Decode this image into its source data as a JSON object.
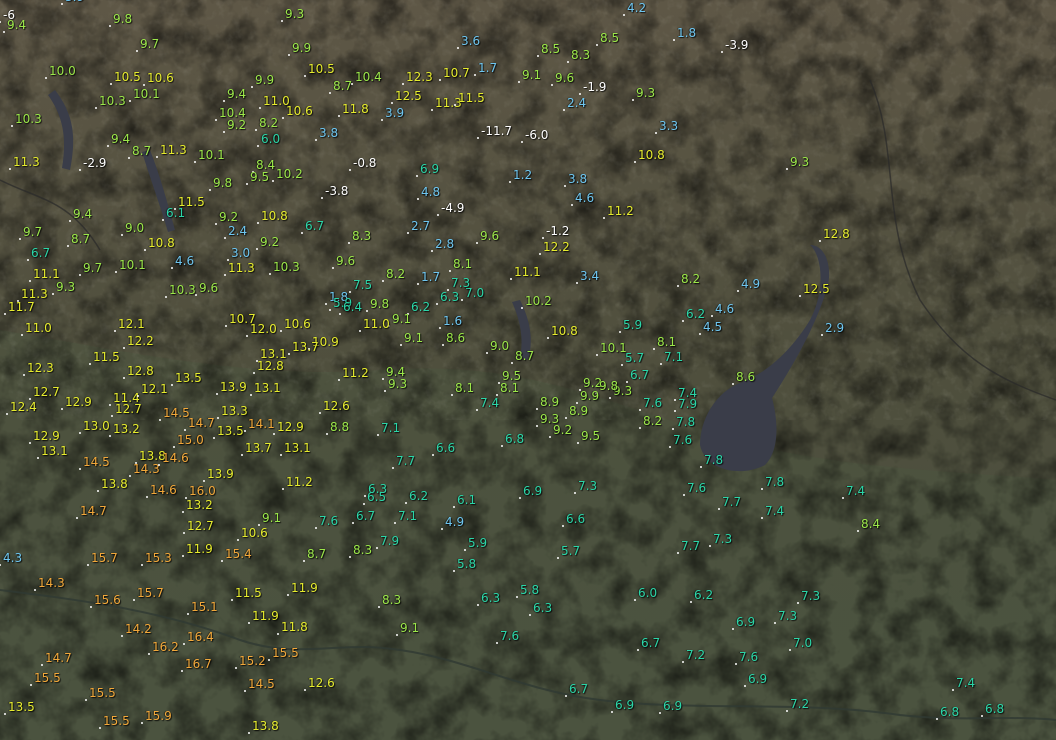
{
  "colors": {
    "mountain": "#55503f",
    "plain": "#4e533f",
    "lake": "#3b3f4a",
    "cold": "#ffffff",
    "cool": "#6ec6f0",
    "mild": "#2bd6a8",
    "warm": "#9ce84a",
    "warmer": "#e6ec2e",
    "hot": "#f2a83a"
  },
  "stations": [
    {
      "t": "-6.0"
    },
    {
      "t": "-3.9"
    },
    {
      "t": "-2.9"
    },
    {
      "t": "-1.9"
    },
    {
      "t": "-1.2"
    },
    {
      "t": "-0.8"
    },
    {
      "t": "-11.7"
    },
    {
      "t": "-3.8"
    },
    {
      "t": "-4.9"
    },
    {
      "t": "1.2"
    },
    {
      "t": "1.6"
    },
    {
      "t": "1.7"
    },
    {
      "t": "1.7"
    },
    {
      "t": "1.8"
    },
    {
      "t": "1.8"
    },
    {
      "t": "2.4"
    },
    {
      "t": "2.4"
    },
    {
      "t": "2.7"
    },
    {
      "t": "2.8"
    },
    {
      "t": "2.9"
    },
    {
      "t": "3.0"
    },
    {
      "t": "3.3"
    },
    {
      "t": "3.4"
    },
    {
      "t": "3.6"
    },
    {
      "t": "3.8"
    },
    {
      "t": "3.8"
    },
    {
      "t": "3.9"
    },
    {
      "t": "4.2"
    },
    {
      "t": "4.5"
    },
    {
      "t": "4.6"
    },
    {
      "t": "4.6"
    },
    {
      "t": "4.6"
    },
    {
      "t": "4.8"
    },
    {
      "t": "4.9"
    },
    {
      "t": "4.9"
    },
    {
      "t": "5.7"
    },
    {
      "t": "5.7"
    },
    {
      "t": "5.8"
    },
    {
      "t": "5.8"
    },
    {
      "t": "5.9"
    },
    {
      "t": "5.9"
    },
    {
      "t": "5.9"
    },
    {
      "t": "6.0"
    },
    {
      "t": "6.0"
    },
    {
      "t": "6.1"
    },
    {
      "t": "6.1"
    },
    {
      "t": "6.2"
    },
    {
      "t": "6.2"
    },
    {
      "t": "6.2"
    },
    {
      "t": "6.2"
    },
    {
      "t": "6.3"
    },
    {
      "t": "6.3"
    },
    {
      "t": "6.3"
    },
    {
      "t": "6.3"
    },
    {
      "t": "6.4"
    },
    {
      "t": "6.5"
    },
    {
      "t": "6.6"
    },
    {
      "t": "6.6"
    },
    {
      "t": "6.7"
    },
    {
      "t": "6.7"
    },
    {
      "t": "6.7"
    },
    {
      "t": "6.7"
    },
    {
      "t": "6.7"
    },
    {
      "t": "6.7"
    },
    {
      "t": "6.8"
    },
    {
      "t": "6.8"
    },
    {
      "t": "6.8"
    },
    {
      "t": "6.9"
    },
    {
      "t": "6.9"
    },
    {
      "t": "6.9"
    },
    {
      "t": "6.9"
    },
    {
      "t": "6.9"
    },
    {
      "t": "6.9"
    },
    {
      "t": "7.0"
    },
    {
      "t": "7.0"
    },
    {
      "t": "7.1"
    },
    {
      "t": "7.1"
    },
    {
      "t": "7.1"
    },
    {
      "t": "7.2"
    },
    {
      "t": "7.2"
    },
    {
      "t": "7.3"
    },
    {
      "t": "7.3"
    },
    {
      "t": "7.3"
    },
    {
      "t": "7.3"
    },
    {
      "t": "7.3"
    },
    {
      "t": "7.4"
    },
    {
      "t": "7.4"
    },
    {
      "t": "7.4"
    },
    {
      "t": "7.4"
    },
    {
      "t": "7.4"
    },
    {
      "t": "7.5"
    },
    {
      "t": "7.6"
    },
    {
      "t": "7.6"
    },
    {
      "t": "7.6"
    },
    {
      "t": "7.6"
    },
    {
      "t": "7.6"
    },
    {
      "t": "7.6"
    },
    {
      "t": "7.7"
    },
    {
      "t": "7.7"
    },
    {
      "t": "7.7"
    },
    {
      "t": "7.8"
    },
    {
      "t": "7.8"
    },
    {
      "t": "7.8"
    },
    {
      "t": "7.9"
    },
    {
      "t": "7.9"
    },
    {
      "t": "8.1"
    },
    {
      "t": "8.1"
    },
    {
      "t": "8.1"
    },
    {
      "t": "8.1"
    },
    {
      "t": "8.2"
    },
    {
      "t": "8.2"
    },
    {
      "t": "8.2"
    },
    {
      "t": "8.2"
    },
    {
      "t": "8.3"
    },
    {
      "t": "8.3"
    },
    {
      "t": "8.3"
    },
    {
      "t": "8.3"
    },
    {
      "t": "8.4"
    },
    {
      "t": "8.4"
    },
    {
      "t": "8.5"
    },
    {
      "t": "8.5"
    },
    {
      "t": "8.6"
    },
    {
      "t": "8.6"
    },
    {
      "t": "8.7"
    },
    {
      "t": "8.7"
    },
    {
      "t": "8.7"
    },
    {
      "t": "8.7"
    },
    {
      "t": "8.7"
    },
    {
      "t": "8.8"
    },
    {
      "t": "8.9"
    },
    {
      "t": "8.9"
    },
    {
      "t": "9.0"
    },
    {
      "t": "9.0"
    },
    {
      "t": "9.1"
    },
    {
      "t": "9.1"
    },
    {
      "t": "9.1"
    },
    {
      "t": "9.1"
    },
    {
      "t": "9.1"
    },
    {
      "t": "9.2"
    },
    {
      "t": "9.2"
    },
    {
      "t": "9.2"
    },
    {
      "t": "9.2"
    },
    {
      "t": "9.2"
    },
    {
      "t": "9.3"
    },
    {
      "t": "9.3"
    },
    {
      "t": "9.3"
    },
    {
      "t": "9.3"
    },
    {
      "t": "9.3"
    },
    {
      "t": "9.3"
    },
    {
      "t": "9.3"
    },
    {
      "t": "9.4"
    },
    {
      "t": "9.4"
    },
    {
      "t": "9.4"
    },
    {
      "t": "9.4"
    },
    {
      "t": "9.4"
    },
    {
      "t": "9.5"
    },
    {
      "t": "9.5"
    },
    {
      "t": "9.5"
    },
    {
      "t": "9.6"
    },
    {
      "t": "9.6"
    },
    {
      "t": "9.6"
    },
    {
      "t": "9.6"
    },
    {
      "t": "9.7"
    },
    {
      "t": "9.7"
    },
    {
      "t": "9.7"
    },
    {
      "t": "9.8"
    },
    {
      "t": "9.8"
    },
    {
      "t": "9.8"
    },
    {
      "t": "9.8"
    },
    {
      "t": "9.9"
    },
    {
      "t": "9.9"
    },
    {
      "t": "9.9"
    },
    {
      "t": "10.0"
    },
    {
      "t": "10.1"
    },
    {
      "t": "10.1"
    },
    {
      "t": "10.1"
    },
    {
      "t": "10.1"
    },
    {
      "t": "10.2"
    },
    {
      "t": "10.2"
    },
    {
      "t": "10.3"
    },
    {
      "t": "10.3"
    },
    {
      "t": "10.3"
    },
    {
      "t": "10.3"
    },
    {
      "t": "10.4"
    },
    {
      "t": "10.4"
    },
    {
      "t": "10.5"
    },
    {
      "t": "10.5"
    },
    {
      "t": "10.6"
    },
    {
      "t": "10.6"
    },
    {
      "t": "10.6"
    },
    {
      "t": "10.6"
    },
    {
      "t": "10.7"
    },
    {
      "t": "10.7"
    },
    {
      "t": "10.8"
    },
    {
      "t": "10.8"
    },
    {
      "t": "10.8"
    },
    {
      "t": "10.8"
    },
    {
      "t": "10.9"
    },
    {
      "t": "11.0"
    },
    {
      "t": "11.0"
    },
    {
      "t": "11.0"
    },
    {
      "t": "11.1"
    },
    {
      "t": "11.1"
    },
    {
      "t": "11.2"
    },
    {
      "t": "11.2"
    },
    {
      "t": "11.2"
    },
    {
      "t": "11.3"
    },
    {
      "t": "11.3"
    },
    {
      "t": "11.3"
    },
    {
      "t": "11.3"
    },
    {
      "t": "11.3"
    },
    {
      "t": "11.4"
    },
    {
      "t": "11.5"
    },
    {
      "t": "11.5"
    },
    {
      "t": "11.5"
    },
    {
      "t": "11.5"
    },
    {
      "t": "11.7"
    },
    {
      "t": "11.8"
    },
    {
      "t": "11.8"
    },
    {
      "t": "11.9"
    },
    {
      "t": "11.9"
    },
    {
      "t": "11.9"
    },
    {
      "t": "12.0"
    },
    {
      "t": "12.1"
    },
    {
      "t": "12.1"
    },
    {
      "t": "12.2"
    },
    {
      "t": "12.2"
    },
    {
      "t": "12.3"
    },
    {
      "t": "12.3"
    },
    {
      "t": "12.4"
    },
    {
      "t": "12.5"
    },
    {
      "t": "12.5"
    },
    {
      "t": "12.6"
    },
    {
      "t": "12.6"
    },
    {
      "t": "12.7"
    },
    {
      "t": "12.7"
    },
    {
      "t": "12.7"
    },
    {
      "t": "12.8"
    },
    {
      "t": "12.8"
    },
    {
      "t": "12.8"
    },
    {
      "t": "12.9"
    },
    {
      "t": "12.9"
    },
    {
      "t": "12.9"
    },
    {
      "t": "13.0"
    },
    {
      "t": "13.1"
    },
    {
      "t": "13.1"
    },
    {
      "t": "13.1"
    },
    {
      "t": "13.1"
    },
    {
      "t": "13.2"
    },
    {
      "t": "13.2"
    },
    {
      "t": "13.3"
    },
    {
      "t": "13.5"
    },
    {
      "t": "13.5"
    },
    {
      "t": "13.5"
    },
    {
      "t": "13.7"
    },
    {
      "t": "13.7"
    },
    {
      "t": "13.8"
    },
    {
      "t": "13.8"
    },
    {
      "t": "13.8"
    },
    {
      "t": "13.9"
    },
    {
      "t": "13.9"
    },
    {
      "t": "14.1"
    },
    {
      "t": "14.2"
    },
    {
      "t": "14.3"
    },
    {
      "t": "14.3"
    },
    {
      "t": "14.5"
    },
    {
      "t": "14.5"
    },
    {
      "t": "14.5"
    },
    {
      "t": "14.6"
    },
    {
      "t": "14.6"
    },
    {
      "t": "14.7"
    },
    {
      "t": "14.7"
    },
    {
      "t": "14.7"
    },
    {
      "t": "15.0"
    },
    {
      "t": "15.1"
    },
    {
      "t": "15.2"
    },
    {
      "t": "15.3"
    },
    {
      "t": "15.4"
    },
    {
      "t": "15.5"
    },
    {
      "t": "15.5"
    },
    {
      "t": "15.5"
    },
    {
      "t": "15.5"
    },
    {
      "t": "15.6"
    },
    {
      "t": "15.7"
    },
    {
      "t": "15.7"
    },
    {
      "t": "15.9"
    },
    {
      "t": "16.0"
    },
    {
      "t": "16.2"
    },
    {
      "t": "16.4"
    },
    {
      "t": "16.7"
    },
    {
      "t": "4.3"
    },
    {
      "t": "-6"
    },
    {
      "t": "3.9"
    }
  ]
}
